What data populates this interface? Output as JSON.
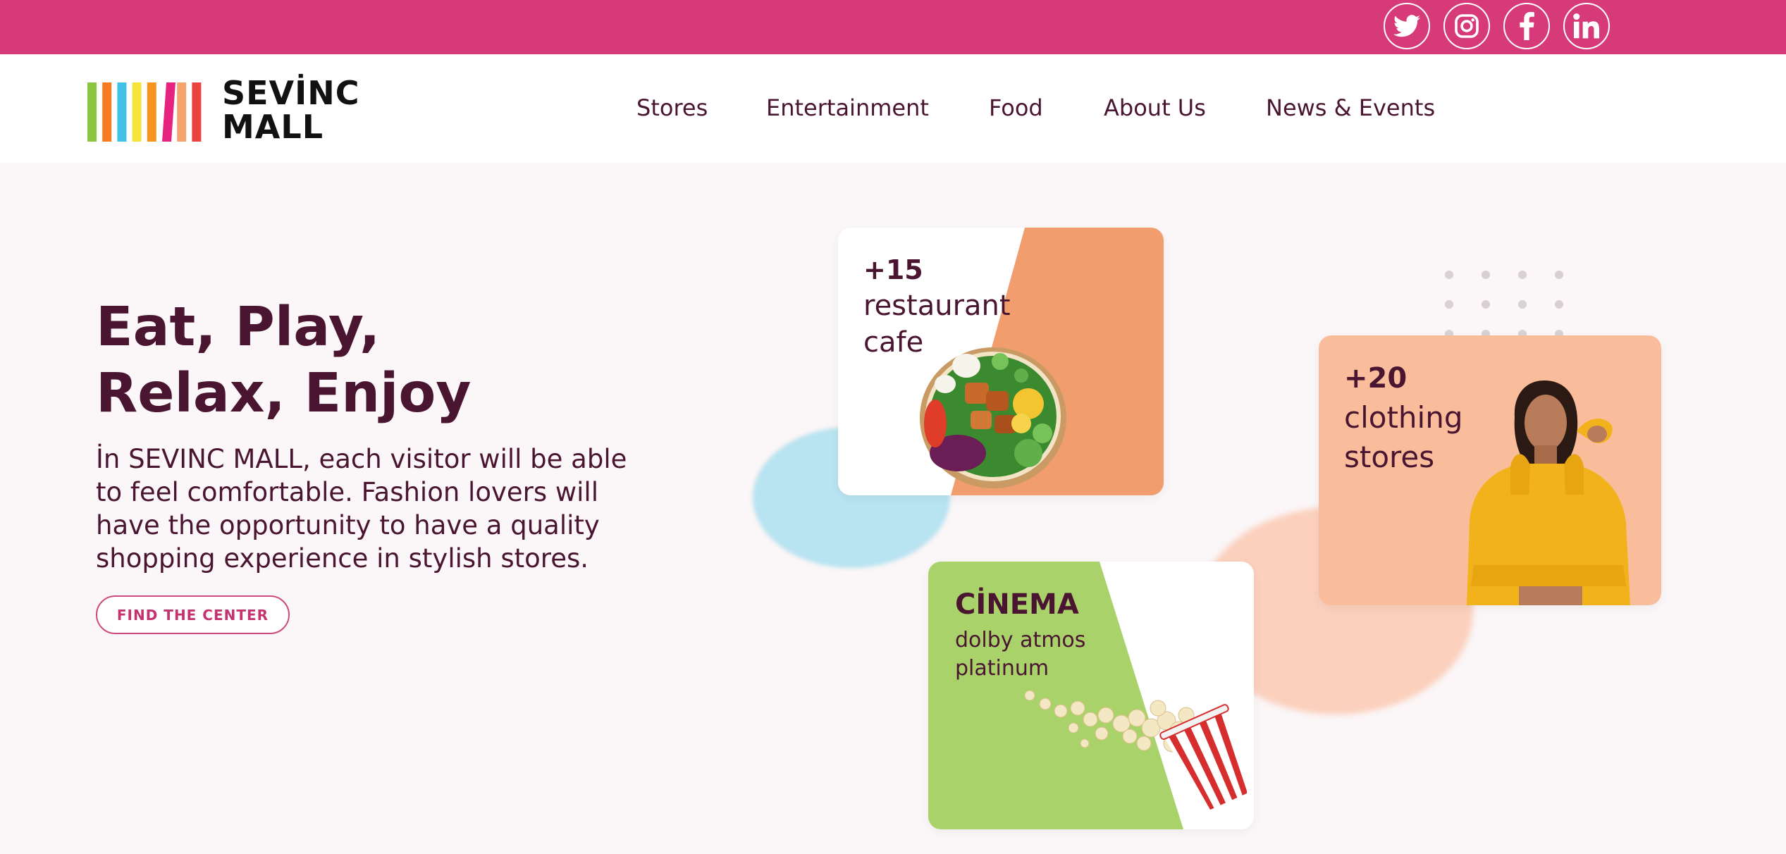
{
  "brand": {
    "name_line1": "SEVİNC",
    "name_line2": "MALL",
    "bar_colors": [
      "#8cc63f",
      "#f47b20",
      "#3fc1e8",
      "#f7e43a",
      "#f7941d",
      "#e6237f",
      "#f4a46c",
      "#ec4240"
    ]
  },
  "social": [
    {
      "name": "twitter-icon",
      "label": "Twitter"
    },
    {
      "name": "instagram-icon",
      "label": "Instagram"
    },
    {
      "name": "facebook-icon",
      "label": "Facebook"
    },
    {
      "name": "linkedin-icon",
      "label": "LinkedIn"
    }
  ],
  "nav": {
    "items": [
      {
        "label": "Stores"
      },
      {
        "label": "Entertainment"
      },
      {
        "label": "Food"
      },
      {
        "label": "About Us"
      },
      {
        "label": "News & Events"
      }
    ]
  },
  "hero": {
    "title_line1": "Eat, Play,",
    "title_line2": "Relax, Enjoy",
    "description_lines": [
      "İn SEVINC MALL, each visitor will be able",
      "to feel comfortable. Fashion lovers will",
      "have the opportunity to have a quality",
      "shopping experience in stylish stores."
    ],
    "cta_label": "FIND THE CENTER"
  },
  "cards": {
    "food": {
      "count": "+15",
      "line1": "restaurant",
      "line2": "cafe",
      "icon": "salad-bowl-image"
    },
    "clothing": {
      "count": "+20",
      "line1": "clothing",
      "line2": "stores",
      "icon": "model-in-yellow-hoodie-image"
    },
    "cinema": {
      "title": "CİNEMA",
      "line1": "dolby atmos",
      "line2": "platinum",
      "icon": "popcorn-bucket-image"
    }
  },
  "colors": {
    "topbar": "#d63a79",
    "text": "#4a1530",
    "food_accent": "#f19d6e",
    "clothing_bg": "#fabd9b",
    "cinema_accent": "#a9d26a",
    "page_bg": "#fbf6f7"
  }
}
